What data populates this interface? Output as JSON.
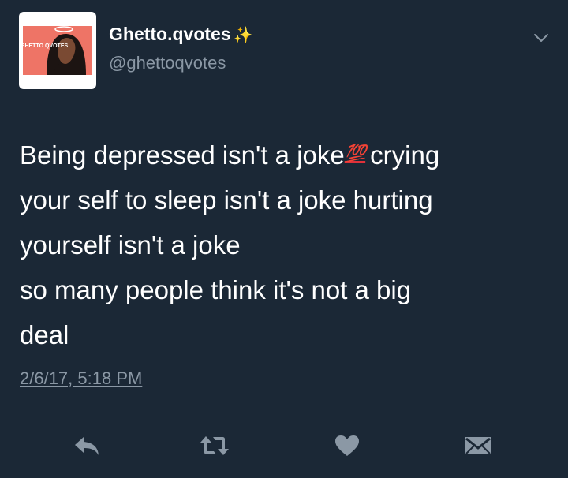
{
  "author": {
    "display_name": "Ghetto.qvotes",
    "name_emoji": "✨",
    "handle": "@ghettoqvotes",
    "avatar_text": "GHETTO QVOTES"
  },
  "tweet": {
    "line1_before": "Being depressed isn't a joke",
    "line1_emoji": "💯",
    "line1_after": "crying",
    "line2": "your self to sleep isn't a joke hurting",
    "line3": "yourself isn't a joke",
    "line4": "so many people think it's not a big",
    "line5": "deal"
  },
  "timestamp": "2/6/17, 5:18 PM",
  "actions": {
    "reply_icon": "reply-icon",
    "retweet_icon": "retweet-icon",
    "like_icon": "heart-icon",
    "dm_icon": "envelope-icon"
  },
  "colors": {
    "background": "#1b2836",
    "secondary_text": "#8b98a5",
    "avatar_bg": "#ee7466",
    "hundred_red": "#e0313a",
    "sparkle": "#f5c84c"
  }
}
